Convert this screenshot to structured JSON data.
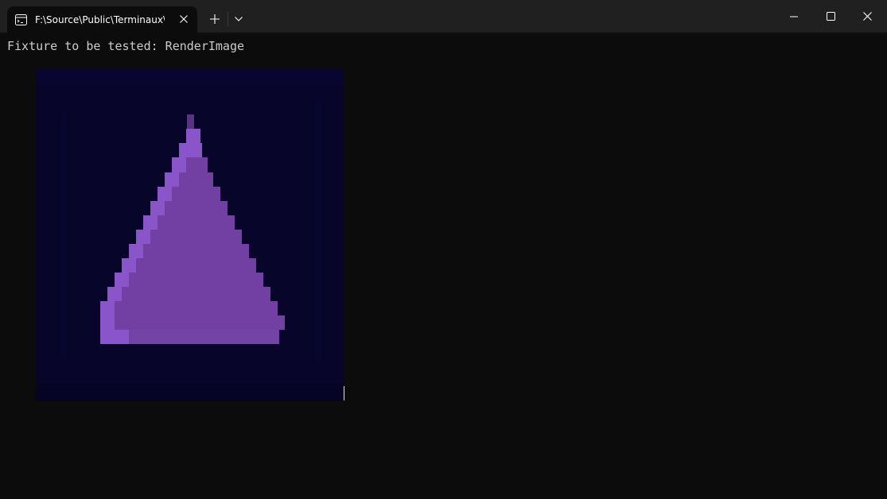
{
  "window": {
    "tab_title": "F:\\Source\\Public\\Terminaux\\T",
    "icons": {
      "tab": "terminal-icon",
      "close_tab": "close-icon",
      "new_tab": "plus-icon",
      "dropdown": "chevron-down-icon",
      "minimize": "minimize-icon",
      "maximize": "maximize-icon",
      "close_window": "close-icon"
    }
  },
  "terminal": {
    "line1": "Fixture to be tested: RenderImage",
    "rendered_image": {
      "subject": "pixelated purple triangle",
      "colors": {
        "background": "#07052a",
        "triangle_light": "#8a55c9",
        "triangle_main": "#7240a2"
      }
    }
  }
}
